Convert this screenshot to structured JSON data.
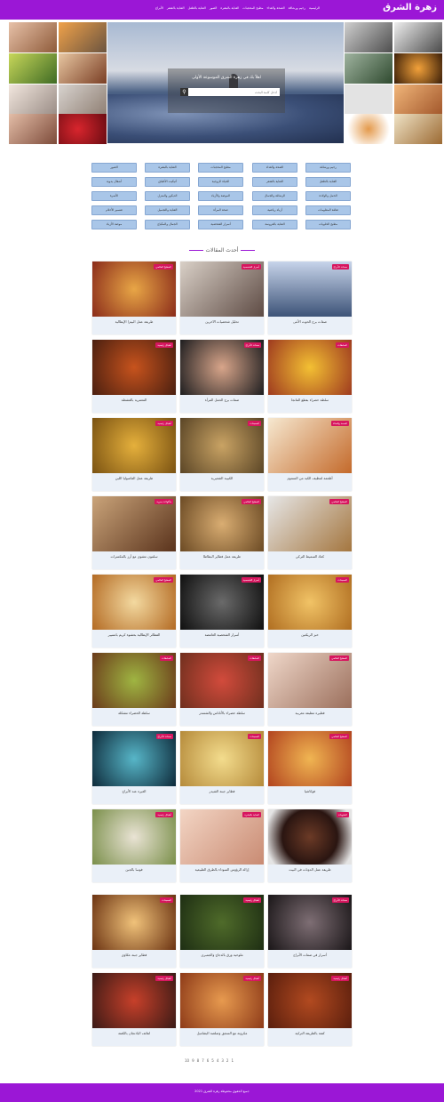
{
  "header": {
    "logo": "زهرة الشرق",
    "nav": [
      "الرئيسية",
      "رجيم ورشاقة",
      "الصحة والغذاء",
      "مطبخ المحجبات",
      "العناية بالبشرة",
      "الصور",
      "العناية بالطفل",
      "العناية بالشعر",
      "الأبراج"
    ]
  },
  "hero": {
    "tagline": "اهلاً بك في زهرة الشرق الموسوعة الأولى",
    "search_placeholder": "أدخل كلمة البحث",
    "search_icon": "search-icon"
  },
  "categories": [
    "رجيم ورشاقة",
    "الصحة والغذاء",
    "مطبخ المحجبات",
    "العناية بالبشرة",
    "الصور",
    "العناية بالطفل",
    "العناية بالشعر",
    "الحياة الزوجية",
    "أتيكيت الأطباق",
    "أشغال يدوية",
    "الحمل والولادة",
    "الرشاقة والجمال",
    "الموضة والأزياء",
    "الديكور والمنزل",
    "الأسرة",
    "ثقافة المعلومات",
    "أزياء رياضية",
    "صحة المرأة",
    "العناية والتجميل",
    "تفسير الأحلام",
    "مطبخ الحلويات",
    "العناية بالعروسة",
    "أسرار الشخصية",
    "الجمال والمكياج",
    "موضة الأزياء"
  ],
  "section_title": "أحدث المقالات",
  "articles": [
    {
      "title": "صفات برج الحوت الأنثى",
      "badge": "صفات الأبراج"
    },
    {
      "title": "تحليل شخصيات الآخرين",
      "badge": "أسرار الشخصية"
    },
    {
      "title": "طريقة عمل البيتزا الإيطالية",
      "badge": "المطبخ العالمي"
    },
    {
      "title": "سلطة خضراء بقطع المانجا",
      "badge": "السلطات"
    },
    {
      "title": "صفات برج الحمل المرأة",
      "badge": "صفات الأبراج"
    },
    {
      "title": "المعمرية بالقشطة",
      "badge": "أطباق رئيسية"
    },
    {
      "title": "أطعمة لتنظيف الكبد من السموم",
      "badge": "الصحة والغذاء"
    },
    {
      "title": "الكبيبة الشعيرية",
      "badge": "المعجنات"
    },
    {
      "title": "طريقة عمل الفاصوليا اللبن",
      "badge": "أطباق رئيسية"
    },
    {
      "title": "كعك السميط التركي",
      "badge": "المطبخ العالمي"
    },
    {
      "title": "طريقة عمل فطاير البطاطا",
      "badge": "المطبخ العالمي"
    },
    {
      "title": "سلمون مشوي مع أرز بالمكسرات",
      "badge": "مأكولات بحرية"
    },
    {
      "title": "خبز الريكتين",
      "badge": "المعجنات"
    },
    {
      "title": "أسرار الشخصية الغامضة",
      "badge": "أسرار الشخصية"
    },
    {
      "title": "الفطائر الإيطالية بحشوة كريم باتسيير",
      "badge": "المطبخ العالمي"
    },
    {
      "title": "فطيرة مطبقة مغربية",
      "badge": "المطبخ العالمي"
    },
    {
      "title": "سلطة خضراء بالأناناس والشمندر",
      "badge": "السلطات"
    },
    {
      "title": "سلطة الخضراء مشكلة",
      "badge": "السلطات"
    },
    {
      "title": "فوكاشيا",
      "badge": "المطبخ العالمي"
    },
    {
      "title": "فطاير جبنة الشيدر",
      "badge": "المعجنات"
    },
    {
      "title": "الغيرة عند الأبراج",
      "badge": "صفات الأبراج"
    },
    {
      "title": "طريقة عمل الدونات في البيت",
      "badge": "الحلويات"
    },
    {
      "title": "إزالة الرؤوس السوداء بالطرق الطبيعية",
      "badge": "العناية بالبشرة"
    },
    {
      "title": "فوسا بالجبن",
      "badge": "أطباق رئيسية"
    },
    {
      "title": "أسرار في صفات الأبراج",
      "badge": "صفات الأبراج"
    },
    {
      "title": "ملوخية ورق بالدجاج والجمبري",
      "badge": "أطباق رئيسية"
    },
    {
      "title": "فطاير جبنة عكاوي",
      "badge": "المعجنات"
    },
    {
      "title": "كفتة بالطريقة التركية",
      "badge": "أطباق رئيسية"
    },
    {
      "title": "مكرونة مع السجق وصلصة البشاميل",
      "badge": "أطباق رئيسية"
    },
    {
      "title": "لفائف الباذنجان بالكفتة",
      "badge": "أطباق رئيسية"
    }
  ],
  "pagination": [
    "1",
    "2",
    "3",
    "4",
    "5",
    "6",
    "7",
    "8",
    "9",
    "10"
  ],
  "footer": {
    "text": "جميع الحقوق محفوظة زهرة الشرق 2021"
  },
  "colors": {
    "brand": "#9b17d6",
    "badge": "#d7165f",
    "category_bg": "#a9c6e8"
  }
}
